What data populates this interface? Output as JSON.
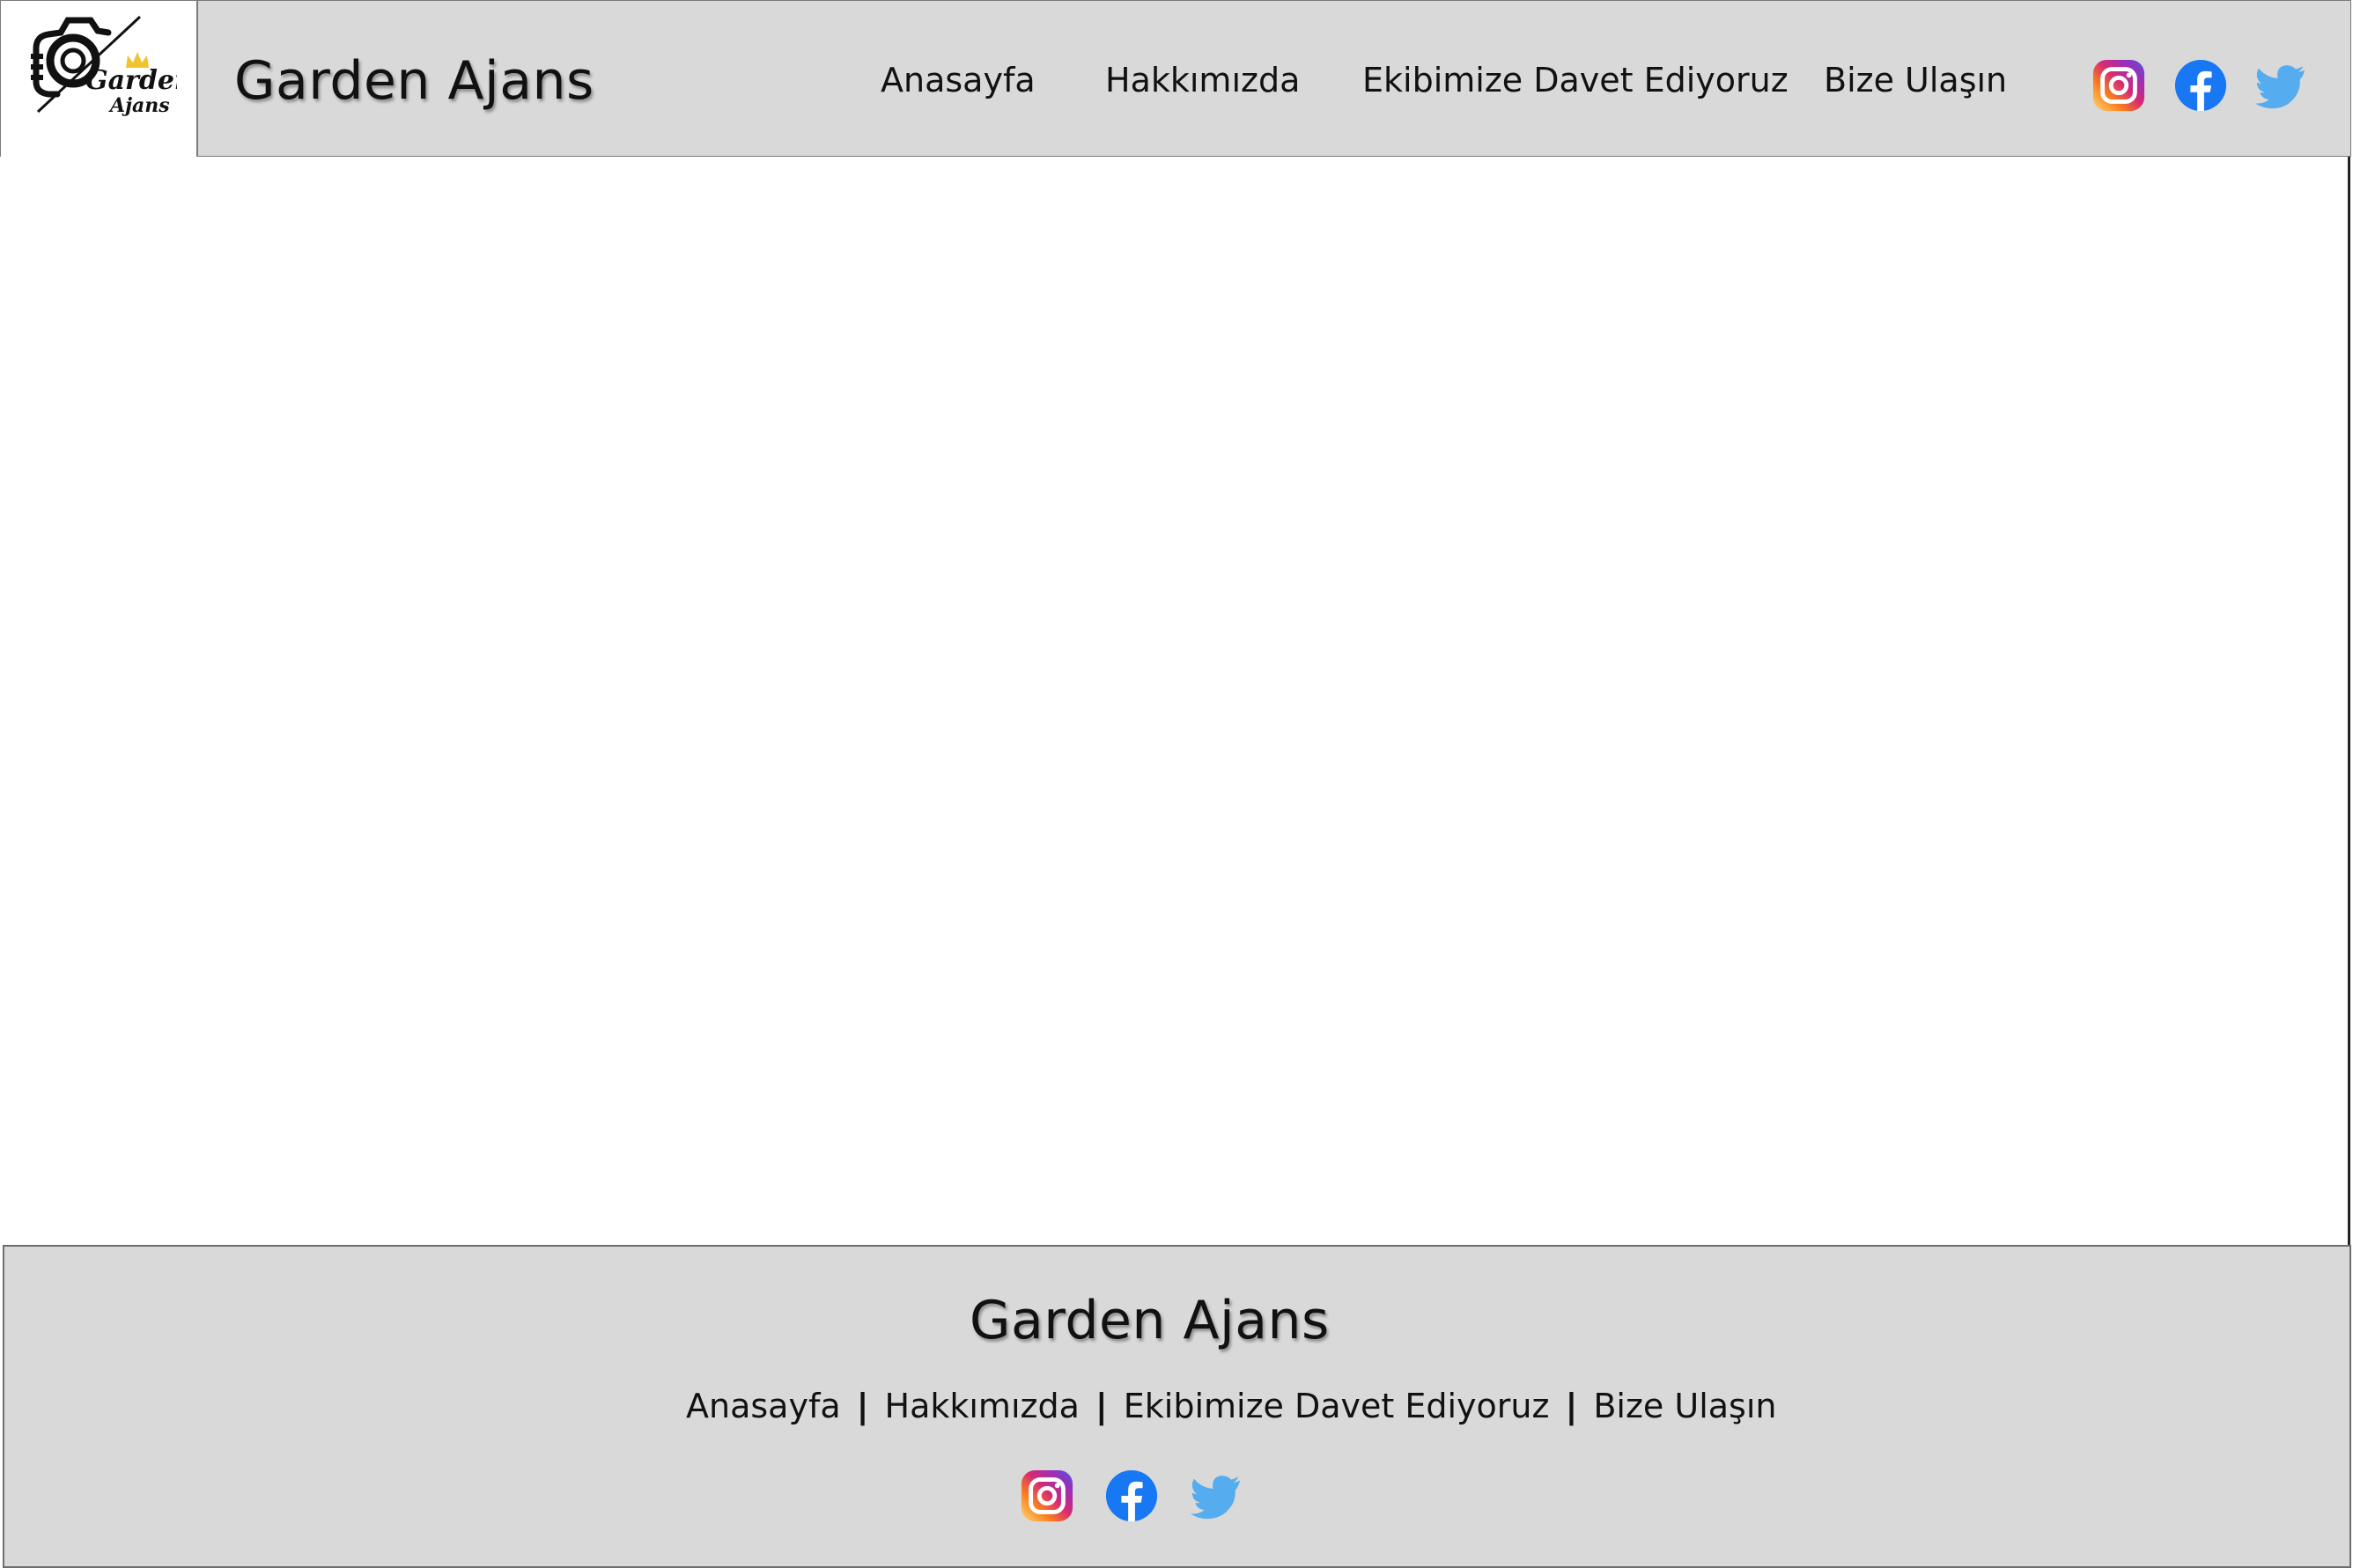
{
  "header": {
    "brand": "Garden Ajans",
    "logo_text_line1": "Garden",
    "logo_text_line2": "Ajans",
    "nav": [
      "Anasayfa",
      "Hakkımızda",
      "Ekibimize Davet Ediyoruz",
      "Bize Ulaşın"
    ],
    "social": [
      "instagram-icon",
      "facebook-icon",
      "twitter-icon"
    ]
  },
  "footer": {
    "brand": "Garden Ajans",
    "links": [
      "Anasayfa",
      "Hakkımızda",
      "Ekibimize Davet Ediyoruz",
      "Bize Ulaşın"
    ],
    "separator": "|",
    "social": [
      "instagram-icon",
      "facebook-icon",
      "twitter-icon"
    ]
  },
  "colors": {
    "bar_bg": "#d9d9d9",
    "facebook": "#1877f2",
    "twitter": "#55acee",
    "instagram_gradient": [
      "#feda75",
      "#fa7e1e",
      "#d62976",
      "#962fbf",
      "#4f5bd5"
    ]
  }
}
